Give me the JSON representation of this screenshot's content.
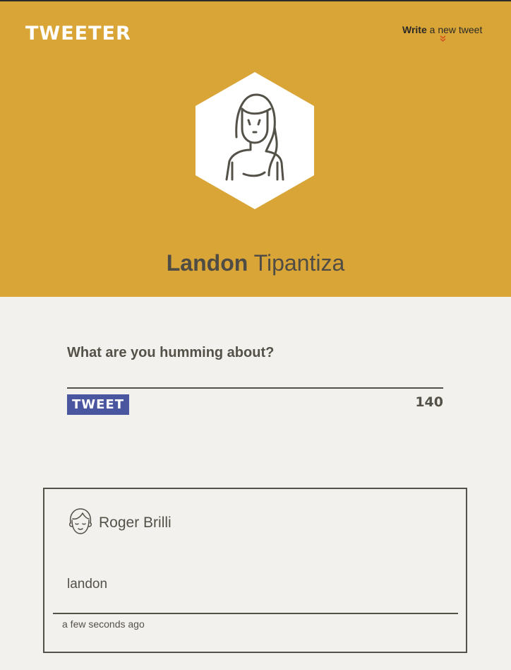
{
  "header": {
    "brand": "TWEETER",
    "compose_toggle": {
      "bold": "Write",
      "rest": " a new tweet"
    },
    "profile": {
      "first_name": "Landon",
      "last_name": "Tipantiza",
      "avatar_icon": "woman-avatar-icon"
    }
  },
  "composer": {
    "prompt": "What are you humming about?",
    "input_value": "",
    "button_label": "TWEET",
    "counter": "140"
  },
  "tweets": [
    {
      "author": "Roger Brilli",
      "avatar_icon": "man-avatar-icon",
      "body": "landon",
      "timestamp": "a few seconds ago"
    }
  ],
  "colors": {
    "header_bg": "#d9a537",
    "page_bg": "#f3f1ed",
    "text": "#545149",
    "button_bg": "#4b56a0",
    "chevron": "#d1531f"
  }
}
